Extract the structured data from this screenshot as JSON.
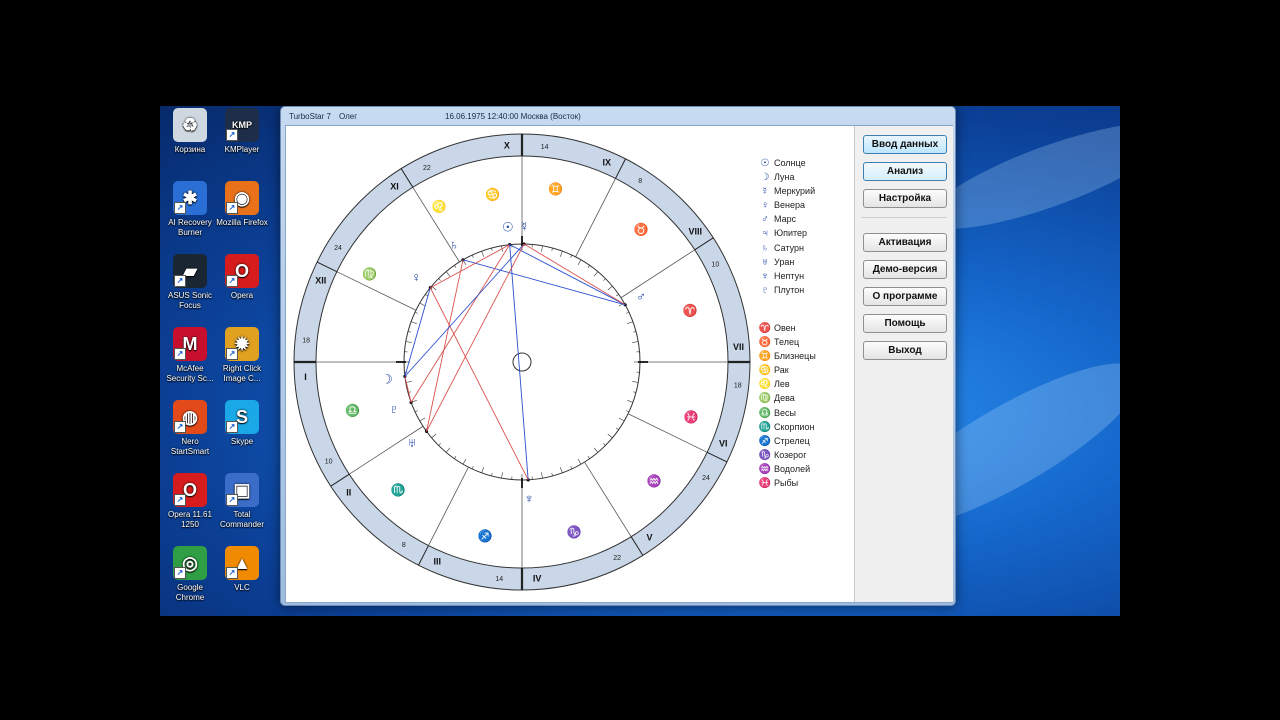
{
  "desktop_icons": [
    {
      "name": "recycle-bin-icon",
      "label": "Корзина",
      "color": "#cfd8e0",
      "glyph": "♻"
    },
    {
      "name": "kmplayer-icon",
      "label": "KMPlayer",
      "color": "#1e2e4a",
      "glyph": "KMP"
    },
    {
      "name": "ai-recovery-burner-icon",
      "label": "AI Recovery Burner",
      "color": "#2a6fd6",
      "glyph": "✱"
    },
    {
      "name": "mozilla-firefox-icon",
      "label": "Mozilla Firefox",
      "color": "#e8711a",
      "glyph": "◉"
    },
    {
      "name": "asus-sonic-focus-icon",
      "label": "ASUS Sonic Focus",
      "color": "#1b2633",
      "glyph": "▰"
    },
    {
      "name": "opera-icon",
      "label": "Opera",
      "color": "#d61c1c",
      "glyph": "O"
    },
    {
      "name": "mcafee-icon",
      "label": "McAfee Security Sc...",
      "color": "#c8102e",
      "glyph": "M"
    },
    {
      "name": "right-click-image-icon",
      "label": "Right Click Image C...",
      "color": "#e0a020",
      "glyph": "✹"
    },
    {
      "name": "nero-startsmart-icon",
      "label": "Nero StartSmart",
      "color": "#e34a1a",
      "glyph": "◍"
    },
    {
      "name": "skype-icon",
      "label": "Skype",
      "color": "#1aa8e6",
      "glyph": "S"
    },
    {
      "name": "opera-11-61-icon",
      "label": "Opera 11.61 1250",
      "color": "#d61c1c",
      "glyph": "O"
    },
    {
      "name": "total-commander-icon",
      "label": "Total Commander",
      "color": "#3a6cc8",
      "glyph": "▣"
    },
    {
      "name": "google-chrome-icon",
      "label": "Google Chrome",
      "color": "#2f9e44",
      "glyph": "◎"
    },
    {
      "name": "vlc-icon",
      "label": "VLC",
      "color": "#f08a00",
      "glyph": "▲"
    }
  ],
  "window": {
    "app_title": "TurboStar 7",
    "person": "Олег",
    "datetime_place": "16.06.1975 12:40:00 Москва (Восток)"
  },
  "buttons": {
    "input_data": "Ввод данных",
    "analysis": "Анализ",
    "settings": "Настройка",
    "activation": "Активация",
    "demo": "Демо-версия",
    "about": "О программе",
    "help": "Помощь",
    "exit": "Выход"
  },
  "planets": [
    {
      "symbol": "☉",
      "label": "Солнце"
    },
    {
      "symbol": "☽",
      "label": "Луна"
    },
    {
      "symbol": "☿",
      "label": "Меркурий"
    },
    {
      "symbol": "♀",
      "label": "Венера"
    },
    {
      "symbol": "♂",
      "label": "Марс"
    },
    {
      "symbol": "♃",
      "label": "Юпитер"
    },
    {
      "symbol": "♄",
      "label": "Сатурн"
    },
    {
      "symbol": "♅",
      "label": "Уран"
    },
    {
      "symbol": "♆",
      "label": "Нептун"
    },
    {
      "symbol": "♇",
      "label": "Плутон"
    }
  ],
  "signs": [
    {
      "symbol": "♈",
      "label": "Овен"
    },
    {
      "symbol": "♉",
      "label": "Телец"
    },
    {
      "symbol": "♊",
      "label": "Близнецы"
    },
    {
      "symbol": "♋",
      "label": "Рак"
    },
    {
      "symbol": "♌",
      "label": "Лев"
    },
    {
      "symbol": "♍",
      "label": "Дева"
    },
    {
      "symbol": "♎",
      "label": "Весы"
    },
    {
      "symbol": "♏",
      "label": "Скорпион"
    },
    {
      "symbol": "♐",
      "label": "Стрелец"
    },
    {
      "symbol": "♑",
      "label": "Козерог"
    },
    {
      "symbol": "♒",
      "label": "Водолей"
    },
    {
      "symbol": "♓",
      "label": "Рыбы"
    }
  ],
  "houses": [
    {
      "numeral": "I",
      "degree": "18"
    },
    {
      "numeral": "II",
      "degree": "10"
    },
    {
      "numeral": "III",
      "degree": "8"
    },
    {
      "numeral": "IV",
      "degree": "14"
    },
    {
      "numeral": "V",
      "degree": "22"
    },
    {
      "numeral": "VI",
      "degree": "24"
    },
    {
      "numeral": "VII",
      "degree": "18"
    },
    {
      "numeral": "VIII",
      "degree": "10"
    },
    {
      "numeral": "IX",
      "degree": "8"
    },
    {
      "numeral": "X",
      "degree": "14"
    },
    {
      "numeral": "XI",
      "degree": "22"
    },
    {
      "numeral": "XII",
      "degree": "24"
    }
  ],
  "colors": {
    "planet": "#1a3fa0",
    "sign": "#c0392b",
    "aspect_hard": "#d9534f",
    "aspect_soft": "#2a4fd0",
    "ring": "#c9d7e8"
  }
}
